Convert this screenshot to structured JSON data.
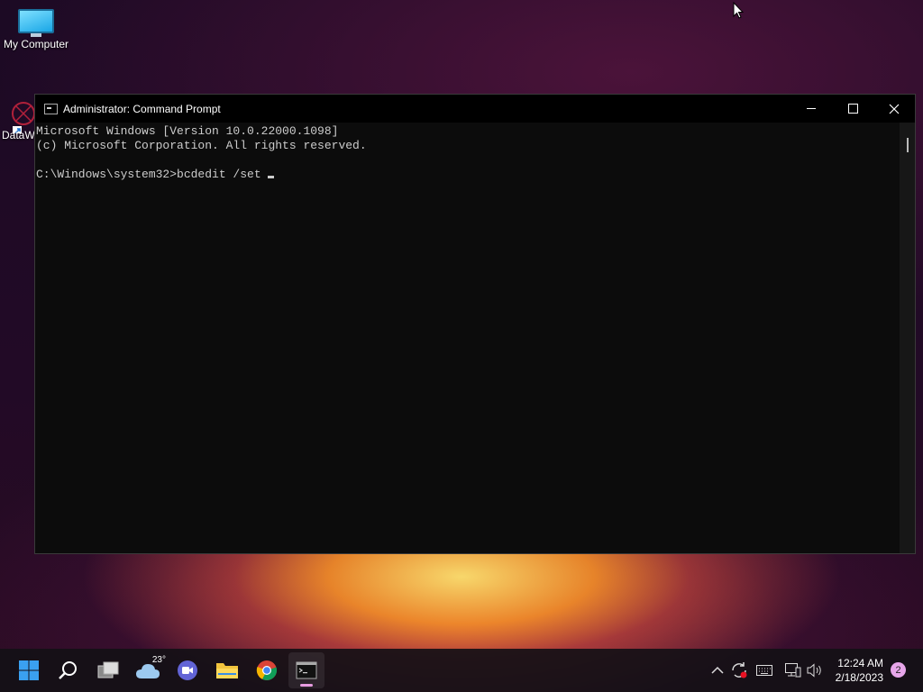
{
  "desktop": {
    "icons": [
      {
        "label": "My Computer"
      },
      {
        "label": "DataW"
      }
    ]
  },
  "window": {
    "title": "Administrator: Command Prompt",
    "console_lines": [
      "Microsoft Windows [Version 10.0.22000.1098]",
      "(c) Microsoft Corporation. All rights reserved.",
      "",
      "C:\\Windows\\system32>bcdedit /set"
    ]
  },
  "taskbar": {
    "weather_temp": "23°",
    "clock_time": "12:24 AM",
    "clock_date": "2/18/2023",
    "notification_count": "2"
  },
  "colors": {
    "accent": "#0078d4",
    "terminal_bg": "#0c0c0c",
    "badge": "#e7a6ea"
  }
}
